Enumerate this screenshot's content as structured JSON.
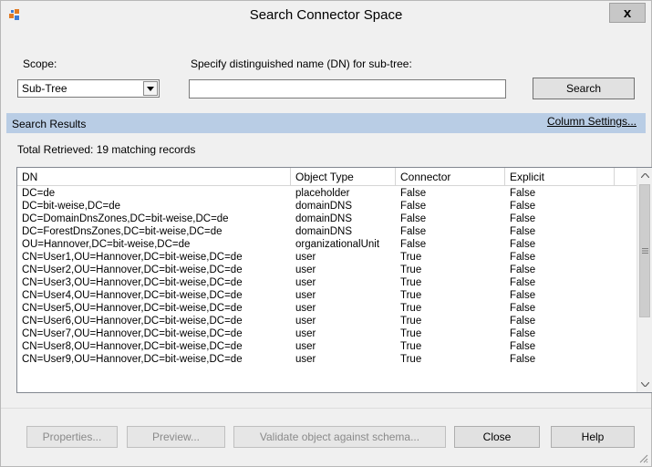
{
  "window": {
    "title": "Search Connector Space",
    "icon": "app-icon",
    "close_label": "x"
  },
  "scope": {
    "label": "Scope:",
    "selected": "Sub-Tree"
  },
  "dn": {
    "label": "Specify distinguished name (DN) for sub-tree:",
    "value": ""
  },
  "search_button": "Search",
  "results": {
    "header": "Search Results",
    "column_settings": "Column Settings...",
    "total": "Total Retrieved: 19 matching records"
  },
  "grid": {
    "columns": [
      "DN",
      "Object Type",
      "Connector",
      "Explicit"
    ],
    "rows": [
      [
        "DC=de",
        "placeholder",
        "False",
        "False"
      ],
      [
        "DC=bit-weise,DC=de",
        "domainDNS",
        "False",
        "False"
      ],
      [
        "DC=DomainDnsZones,DC=bit-weise,DC=de",
        "domainDNS",
        "False",
        "False"
      ],
      [
        "DC=ForestDnsZones,DC=bit-weise,DC=de",
        "domainDNS",
        "False",
        "False"
      ],
      [
        "OU=Hannover,DC=bit-weise,DC=de",
        "organizationalUnit",
        "False",
        "False"
      ],
      [
        "CN=User1,OU=Hannover,DC=bit-weise,DC=de",
        "user",
        "True",
        "False"
      ],
      [
        "CN=User2,OU=Hannover,DC=bit-weise,DC=de",
        "user",
        "True",
        "False"
      ],
      [
        "CN=User3,OU=Hannover,DC=bit-weise,DC=de",
        "user",
        "True",
        "False"
      ],
      [
        "CN=User4,OU=Hannover,DC=bit-weise,DC=de",
        "user",
        "True",
        "False"
      ],
      [
        "CN=User5,OU=Hannover,DC=bit-weise,DC=de",
        "user",
        "True",
        "False"
      ],
      [
        "CN=User6,OU=Hannover,DC=bit-weise,DC=de",
        "user",
        "True",
        "False"
      ],
      [
        "CN=User7,OU=Hannover,DC=bit-weise,DC=de",
        "user",
        "True",
        "False"
      ],
      [
        "CN=User8,OU=Hannover,DC=bit-weise,DC=de",
        "user",
        "True",
        "False"
      ],
      [
        "CN=User9,OU=Hannover,DC=bit-weise,DC=de",
        "user",
        "True",
        "False"
      ]
    ]
  },
  "buttons": {
    "properties": "Properties...",
    "preview": "Preview...",
    "validate": "Validate object against schema...",
    "close": "Close",
    "help": "Help"
  },
  "colors": {
    "results_band": "#b9cde5",
    "window_bg": "#f0f0f0",
    "close_button": "#c7c7c7"
  }
}
